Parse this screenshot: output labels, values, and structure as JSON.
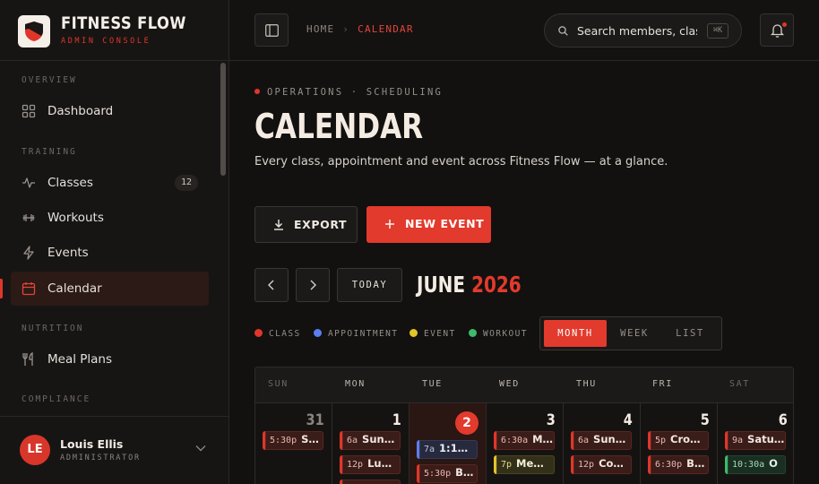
{
  "brand": {
    "name": "FITNESS FLOW",
    "subtitle": "ADMIN CONSOLE"
  },
  "sidebar": {
    "sections": [
      {
        "label": "OVERVIEW"
      },
      {
        "label": "TRAINING"
      },
      {
        "label": "NUTRITION"
      },
      {
        "label": "COMPLIANCE"
      }
    ],
    "items": [
      {
        "label": "Dashboard",
        "icon": "grid-icon"
      },
      {
        "label": "Classes",
        "icon": "activity-icon",
        "badge": "12"
      },
      {
        "label": "Workouts",
        "icon": "dumbbell-icon"
      },
      {
        "label": "Events",
        "icon": "lightning-icon"
      },
      {
        "label": "Calendar",
        "icon": "calendar-icon",
        "active": true
      },
      {
        "label": "Meal Plans",
        "icon": "utensils-icon"
      }
    ],
    "user": {
      "initials": "LE",
      "name": "Louis Ellis",
      "role": "ADMINISTRATOR"
    }
  },
  "topbar": {
    "breadcrumb": {
      "home": "HOME",
      "separator": "›",
      "current": "CALENDAR"
    },
    "search": {
      "placeholder": "Search members, classes…",
      "shortcut": "⌘K"
    }
  },
  "page": {
    "eyebrow": "OPERATIONS · SCHEDULING",
    "title": "CALENDAR",
    "description": "Every class, appointment and event across Fitness Flow — at a glance.",
    "export_label": "EXPORT",
    "new_event_label": "NEW EVENT"
  },
  "calendar": {
    "today_label": "TODAY",
    "month": "JUNE",
    "year": "2026",
    "legend": [
      {
        "label": "CLASS",
        "color": "#e0362a"
      },
      {
        "label": "APPOINTMENT",
        "color": "#5a7ef0"
      },
      {
        "label": "EVENT",
        "color": "#e3c428"
      },
      {
        "label": "WORKOUT",
        "color": "#3fba6a"
      }
    ],
    "views": [
      {
        "label": "MONTH",
        "active": true
      },
      {
        "label": "WEEK",
        "active": false
      },
      {
        "label": "LIST",
        "active": false
      }
    ],
    "weekdays": [
      "SUN",
      "MON",
      "TUE",
      "WED",
      "THU",
      "FRI",
      "SAT"
    ],
    "days": [
      {
        "num": "31",
        "events": [
          {
            "time": "5:30p",
            "name": "S…",
            "kind": "class"
          }
        ]
      },
      {
        "num": "1",
        "events": [
          {
            "time": "6a",
            "name": "Sun…",
            "kind": "class"
          },
          {
            "time": "12p",
            "name": "Lu…",
            "kind": "class"
          }
        ]
      },
      {
        "num": "2",
        "today": true,
        "events": [
          {
            "time": "7a",
            "name": "1:1…",
            "kind": "appt"
          },
          {
            "time": "5:30p",
            "name": "B…",
            "kind": "class"
          }
        ]
      },
      {
        "num": "3",
        "events": [
          {
            "time": "6:30a",
            "name": "M…",
            "kind": "class"
          },
          {
            "time": "7p",
            "name": "Me…",
            "kind": "event"
          }
        ]
      },
      {
        "num": "4",
        "events": [
          {
            "time": "6a",
            "name": "Sun…",
            "kind": "class"
          },
          {
            "time": "12p",
            "name": "Co…",
            "kind": "class"
          }
        ]
      },
      {
        "num": "5",
        "events": [
          {
            "time": "5p",
            "name": "Cro…",
            "kind": "class"
          },
          {
            "time": "6:30p",
            "name": "B…",
            "kind": "class"
          }
        ]
      },
      {
        "num": "6",
        "events": [
          {
            "time": "9a",
            "name": "Satu…",
            "kind": "class"
          },
          {
            "time": "10:30a",
            "name": "O",
            "kind": "workout"
          }
        ]
      }
    ]
  }
}
